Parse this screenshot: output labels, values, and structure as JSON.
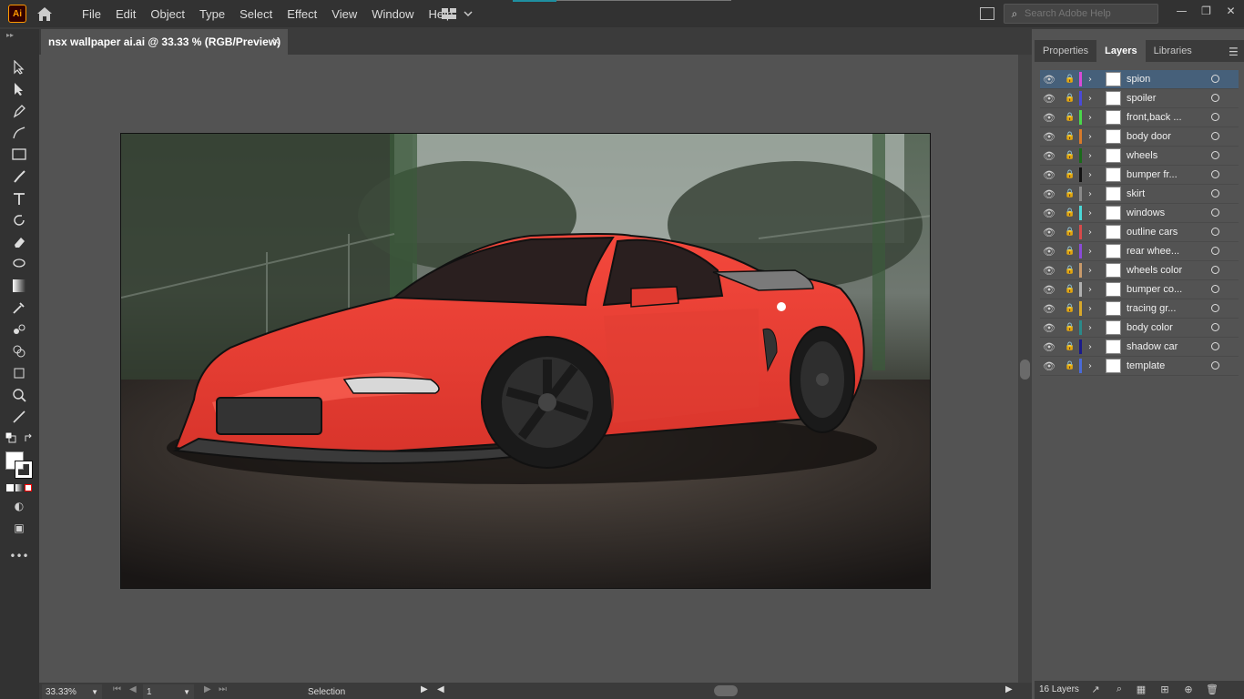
{
  "app": {
    "logo_text": "Ai"
  },
  "menus": [
    "File",
    "Edit",
    "Object",
    "Type",
    "Select",
    "Effect",
    "View",
    "Window",
    "Help"
  ],
  "search": {
    "placeholder": "Search Adobe Help"
  },
  "window_controls": {
    "minimize": "—",
    "restore": "❐",
    "close": "✕"
  },
  "document": {
    "tab_title": "nsx wallpaper ai.ai @ 33.33 % (RGB/Preview)",
    "close": "×"
  },
  "status": {
    "zoom": "33.33%",
    "page": "1",
    "tool": "Selection"
  },
  "panel": {
    "tabs": [
      "Properties",
      "Layers",
      "Libraries"
    ],
    "active_tab": "Layers",
    "layer_count": "16 Layers",
    "layers": [
      {
        "name": "spion",
        "color": "#d84ad8",
        "selected": true
      },
      {
        "name": "spoiler",
        "color": "#4a4ad8"
      },
      {
        "name": "front,back ...",
        "color": "#4ad84a"
      },
      {
        "name": "body door",
        "color": "#d87a2a"
      },
      {
        "name": "wheels",
        "color": "#1a6a1a"
      },
      {
        "name": "bumper fr...",
        "color": "#111111"
      },
      {
        "name": "skirt",
        "color": "#8a8a8a"
      },
      {
        "name": "windows",
        "color": "#4ad8d8"
      },
      {
        "name": "outline cars",
        "color": "#d84a4a"
      },
      {
        "name": "rear whee...",
        "color": "#8a4ad8"
      },
      {
        "name": "wheels color",
        "color": "#c89a6a"
      },
      {
        "name": "bumper co...",
        "color": "#b0b0b0"
      },
      {
        "name": "tracing gr...",
        "color": "#d8a82a"
      },
      {
        "name": "body color",
        "color": "#2a8a8a"
      },
      {
        "name": "shadow car",
        "color": "#1a1a8a"
      },
      {
        "name": "template",
        "color": "#4a6ad8"
      }
    ]
  }
}
